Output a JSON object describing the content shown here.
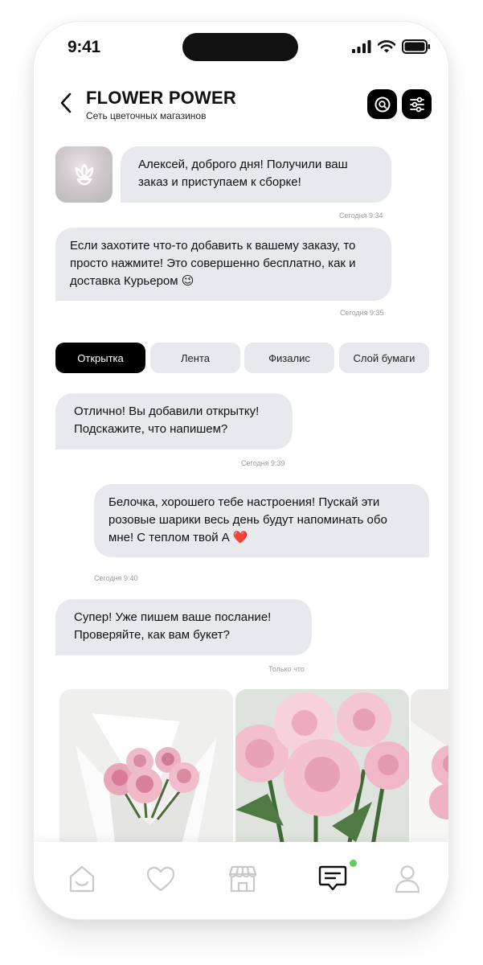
{
  "status_bar": {
    "time": "9:41"
  },
  "header": {
    "title": "FLOWER POWER",
    "subtitle": "Сеть цветочных магазинов"
  },
  "messages": [
    {
      "text": "Алексей, доброго дня! Получили ваш заказ и приступаем к сборке!",
      "time": "Сегодня 9:34",
      "from": "shop"
    },
    {
      "text": "Если захотите что-то добавить к вашему заказу, то просто нажмите! Это совершенно бесплатно, как и доставка Курьером 😉",
      "time": "Сегодня 9:35",
      "from": "shop"
    },
    {
      "text": "Отлично! Вы добавили открытку! Подскажите, что напишем?",
      "time": "Сегодня 9:39",
      "from": "shop"
    },
    {
      "text": "Белочка, хорошего тебе настроения! Пускай эти розовые шарики весь день будут напоминать обо мне! С теплом твой А ❤️",
      "time": "Сегодня 9:40",
      "from": "user"
    },
    {
      "text": "Супер! Уже пишем ваше послание! Проверяйте, как вам букет?",
      "time": "Только что",
      "from": "shop"
    }
  ],
  "chips": [
    {
      "label": "Открытка",
      "active": true
    },
    {
      "label": "Лента",
      "active": false
    },
    {
      "label": "Физалис",
      "active": false
    },
    {
      "label": "Слой бумаги",
      "active": false
    }
  ],
  "icons": {
    "back": "chevron-left-icon",
    "search": "search-icon",
    "filter": "sliders-icon",
    "tabs": [
      "home-icon",
      "heart-icon",
      "shop-icon",
      "chat-icon",
      "profile-icon"
    ]
  },
  "colors": {
    "bubble": "#e8e9ec",
    "active_chip": "#000000",
    "notification": "#5ad15a",
    "tab_inactive": "#c9c9c9"
  },
  "tabbar": {
    "active": "chat"
  }
}
